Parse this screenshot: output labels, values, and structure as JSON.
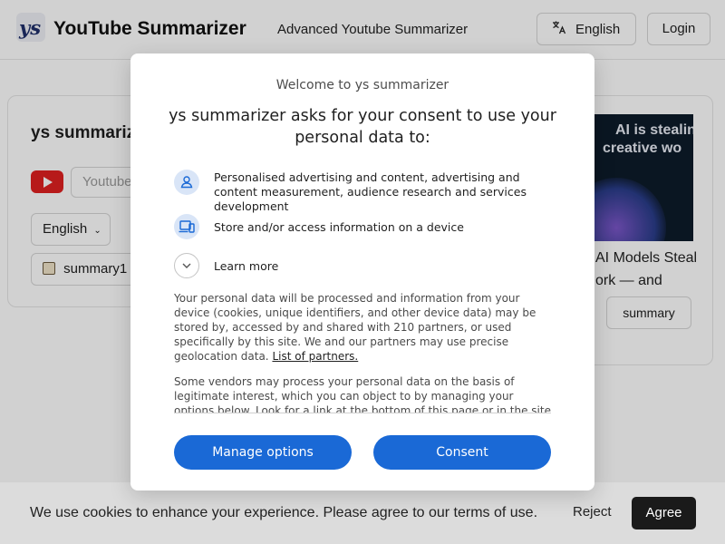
{
  "header": {
    "brand": "YouTube Summarizer",
    "nav_link": "Advanced Youtube Summarizer",
    "language_button": "English",
    "login_button": "Login"
  },
  "main": {
    "title": "ys summarizer",
    "url_placeholder": "Youtube",
    "language_select": "English",
    "summary_select": "summary1"
  },
  "video_card": {
    "thumbnail_text_line1": "AI is stealin",
    "thumbnail_text_line2": "creative wo",
    "title_line1": "AI Models Steal",
    "title_line2": "ork — and",
    "summary_button": "summary"
  },
  "consent_dialog": {
    "welcome": "Welcome to ys summarizer",
    "headline": "ys summarizer asks for your consent to use your personal data to:",
    "purposes": [
      {
        "icon": "person-icon",
        "text": "Personalised advertising and content, advertising and content measurement, audience research and services development"
      },
      {
        "icon": "device-icon",
        "text": "Store and/or access information on a device"
      }
    ],
    "learn_more": "Learn more",
    "paragraph1": "Your personal data will be processed and information from your device (cookies, unique identifiers, and other device data) may be stored by, accessed by and shared with 210 partners, or used specifically by this site. We and our partners may use precise geolocation data.",
    "partners_link": "List of partners.",
    "paragraph2": "Some vendors may process your personal data on the basis of legitimate interest, which you can object to by managing your options below. Look for a link at the bottom of this page or in the site menu to manage or withdraw consent in privacy and cookie settings.",
    "manage_button": "Manage options",
    "consent_button": "Consent"
  },
  "cookie_bar": {
    "text": "We use cookies to enhance your experience. Please agree to our terms of use.",
    "reject_button": "Reject",
    "agree_button": "Agree"
  },
  "colors": {
    "primary_blue": "#1a69d6",
    "youtube_red": "#e02020",
    "agree_dark": "#1a1a1a"
  }
}
